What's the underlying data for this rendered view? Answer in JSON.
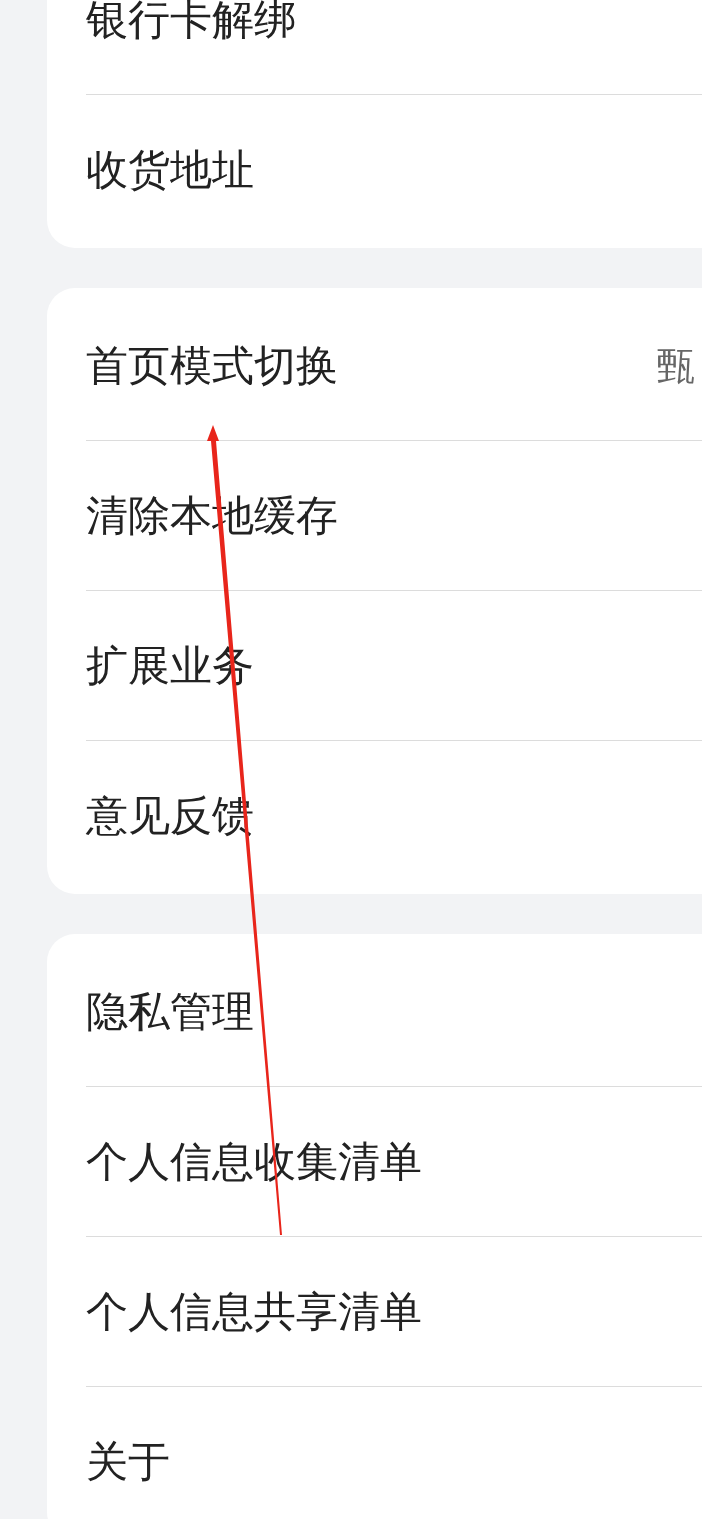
{
  "groups": [
    {
      "items": [
        {
          "label": "银行卡解绑"
        },
        {
          "label": "收货地址"
        }
      ]
    },
    {
      "items": [
        {
          "label": "首页模式切换",
          "value": "甄"
        },
        {
          "label": "清除本地缓存"
        },
        {
          "label": "扩展业务"
        },
        {
          "label": "意见反馈"
        }
      ]
    },
    {
      "items": [
        {
          "label": "隐私管理"
        },
        {
          "label": "个人信息收集清单"
        },
        {
          "label": "个人信息共享清单"
        },
        {
          "label": "关于"
        }
      ]
    }
  ]
}
